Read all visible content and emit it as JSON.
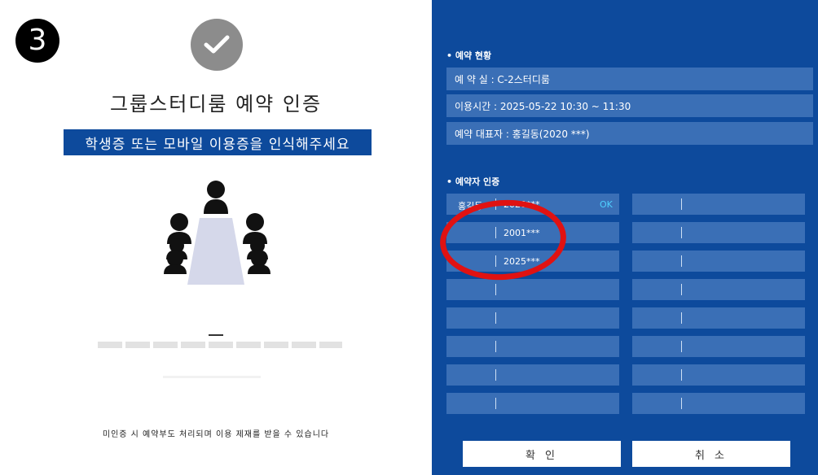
{
  "step_badge": "3",
  "left_panel": {
    "title": "그룹스터디룸 예약 인증",
    "instruction": "학생증 또는 모바일 이용증을 인식해주세요",
    "notice": "미인증 시 예약부도 처리되며 이용 제재를 받을 수 있습니다",
    "icons": {
      "status": "check-icon",
      "illustration": "meeting-people-icon"
    }
  },
  "reservation_status": {
    "section_title": "• 예약 현황",
    "room": "예 약 실 : C-2스터디룸",
    "time": "이용시간 : 2025-05-22 10:30 ~ 11:30",
    "representative": "예약 대표자 :  홍길동(2020 ***)"
  },
  "reservers": {
    "section_title": "• 예약자 인증",
    "left_column": [
      {
        "name": "홍길동",
        "id": "2020***",
        "status": "OK"
      },
      {
        "name": "",
        "id": "2001***",
        "status": ""
      },
      {
        "name": "",
        "id": "2025***",
        "status": ""
      },
      {
        "name": "",
        "id": "",
        "status": ""
      },
      {
        "name": "",
        "id": "",
        "status": ""
      },
      {
        "name": "",
        "id": "",
        "status": ""
      },
      {
        "name": "",
        "id": "",
        "status": ""
      },
      {
        "name": "",
        "id": "",
        "status": ""
      }
    ],
    "right_column": [
      {
        "name": "",
        "id": ""
      },
      {
        "name": "",
        "id": ""
      },
      {
        "name": "",
        "id": ""
      },
      {
        "name": "",
        "id": ""
      },
      {
        "name": "",
        "id": ""
      },
      {
        "name": "",
        "id": ""
      },
      {
        "name": "",
        "id": ""
      },
      {
        "name": "",
        "id": ""
      }
    ]
  },
  "buttons": {
    "confirm": "확 인",
    "cancel": "취 소"
  },
  "colors": {
    "panel_blue": "#0d4a9c",
    "cell_blue": "#3a6fb6",
    "highlight_red": "#e01212",
    "ok_cyan": "#4fd0ff"
  }
}
